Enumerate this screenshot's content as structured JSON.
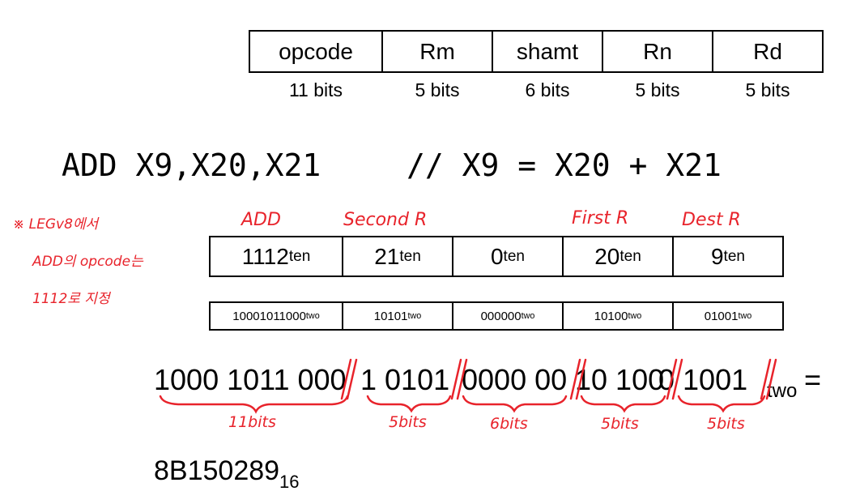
{
  "format": {
    "fields": [
      "opcode",
      "Rm",
      "shamt",
      "Rn",
      "Rd"
    ],
    "bits": [
      "11 bits",
      "5 bits",
      "6 bits",
      "5 bits",
      "5 bits"
    ]
  },
  "instruction": {
    "asm": "ADD X9,X20,X21",
    "comment": "// X9 = X20 + X21"
  },
  "annotations": {
    "note_lines": [
      "※ LEGv8에서",
      "ADD의 opcode는",
      "1112로 지정"
    ],
    "labels": [
      "ADD",
      "Second R",
      "First R",
      "Dest R"
    ],
    "bit_counts": [
      "11bits",
      "5bits",
      "6bits",
      "5bits",
      "5bits"
    ]
  },
  "decimal": {
    "values": [
      "1112",
      "21",
      "0",
      "20",
      "9"
    ],
    "suffix": "ten"
  },
  "binary": {
    "values": [
      "10001011000",
      "10101",
      "000000",
      "10100",
      "01001"
    ],
    "suffix": "two"
  },
  "full_binary": {
    "segments": [
      "1000 1011 000",
      "1 0101",
      "0000 00",
      "10 100",
      "0 1001"
    ],
    "suffix": "two",
    "equals": "="
  },
  "hex": {
    "value": "8B150289",
    "base": "16"
  }
}
